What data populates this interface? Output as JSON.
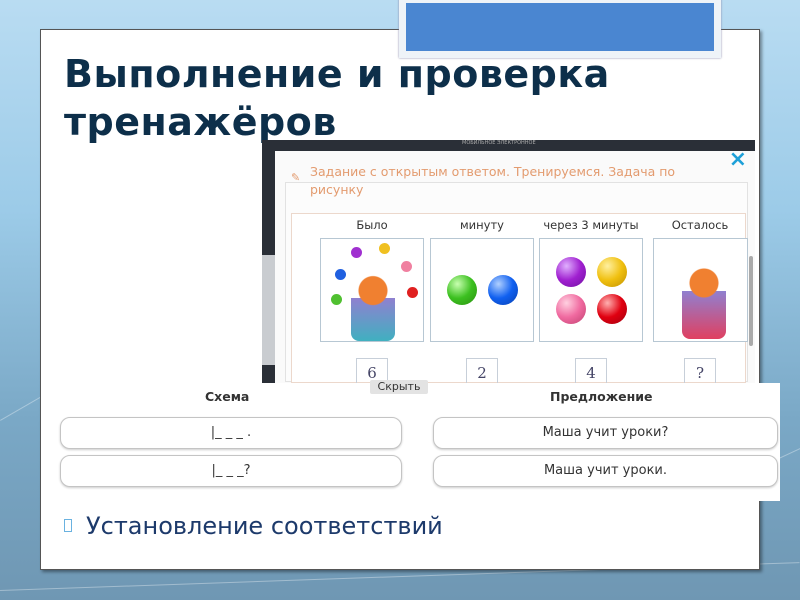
{
  "slide": {
    "title_line1": "Выполнение и проверка",
    "title_line2": "тренажёров",
    "bullet": "Установление соответствий"
  },
  "trainer": {
    "header_logo_text": "МОБИЛЬНОЕ ЭЛЕКТРОННОЕ",
    "task_title": "Задание с открытым ответом. Тренируемся. Задача по рисунку",
    "close_icon": "×",
    "columns": [
      {
        "label": "Было",
        "value": "6"
      },
      {
        "label": "минуту",
        "value": "2"
      },
      {
        "label": "через 3 минуты",
        "value": "4"
      },
      {
        "label": "Осталось",
        "value": "?"
      }
    ],
    "hide_button": "Скрыть"
  },
  "matching": {
    "scheme_header": "Схема",
    "sentence_header": "Предложение",
    "schemes": [
      "|_ _ _ .",
      "|_ _ _?"
    ],
    "sentences": [
      "Маша учит уроки?",
      "Маша учит уроки."
    ]
  },
  "colors": {
    "accent": "#4a86d1",
    "title": "#0d2f4a",
    "task": "#e39b6f",
    "close": "#1ea0d8"
  }
}
